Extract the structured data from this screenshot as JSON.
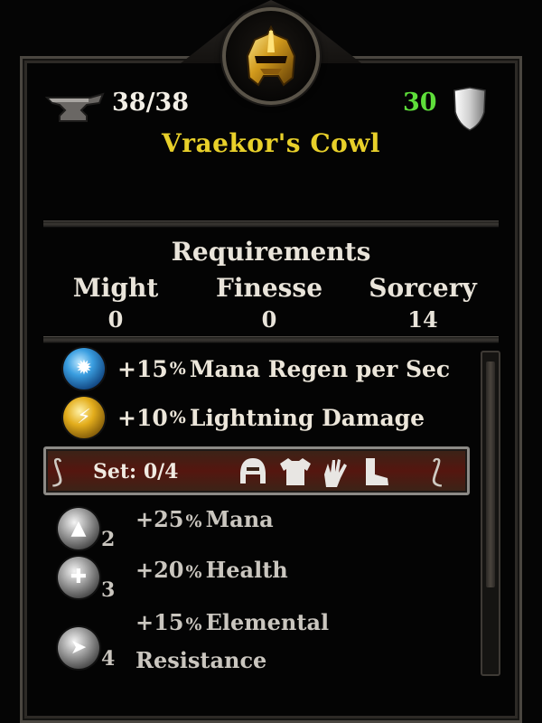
{
  "item": {
    "name": "Vraekor's Cowl",
    "durability": "38/38",
    "armor": "30",
    "portrait_icon": "golden-helmet-icon",
    "colors": {
      "name": "#e8d02a",
      "armor": "#5ede3a",
      "set_bar": "#55160f"
    }
  },
  "requirements": {
    "title": "Requirements",
    "columns": [
      {
        "label": "Might",
        "value": "0"
      },
      {
        "label": "Finesse",
        "value": "0"
      },
      {
        "label": "Sorcery",
        "value": "14"
      }
    ]
  },
  "stats": [
    {
      "value": "+15",
      "pct": "%",
      "text": "Mana Regen per Sec",
      "icon": "mana-regen-orb-icon"
    },
    {
      "value": "+10",
      "pct": "%",
      "text": "Lightning Damage",
      "icon": "lightning-orb-icon"
    }
  ],
  "set": {
    "label": "Set: 0/4",
    "pieces": [
      "helm-icon",
      "chest-armor-icon",
      "gauntlet-icon",
      "boot-icon"
    ],
    "bonuses": [
      {
        "count": "2",
        "value": "+25",
        "pct": "%",
        "text": "Mana",
        "icon": "mana-orb-icon"
      },
      {
        "count": "3",
        "value": "+20",
        "pct": "%",
        "text": "Health",
        "icon": "health-orb-icon"
      },
      {
        "count": "4",
        "value": "+15",
        "pct": "%",
        "text": "Elemental",
        "text2": "Resistance",
        "icon": "resistance-orb-icon"
      }
    ]
  }
}
